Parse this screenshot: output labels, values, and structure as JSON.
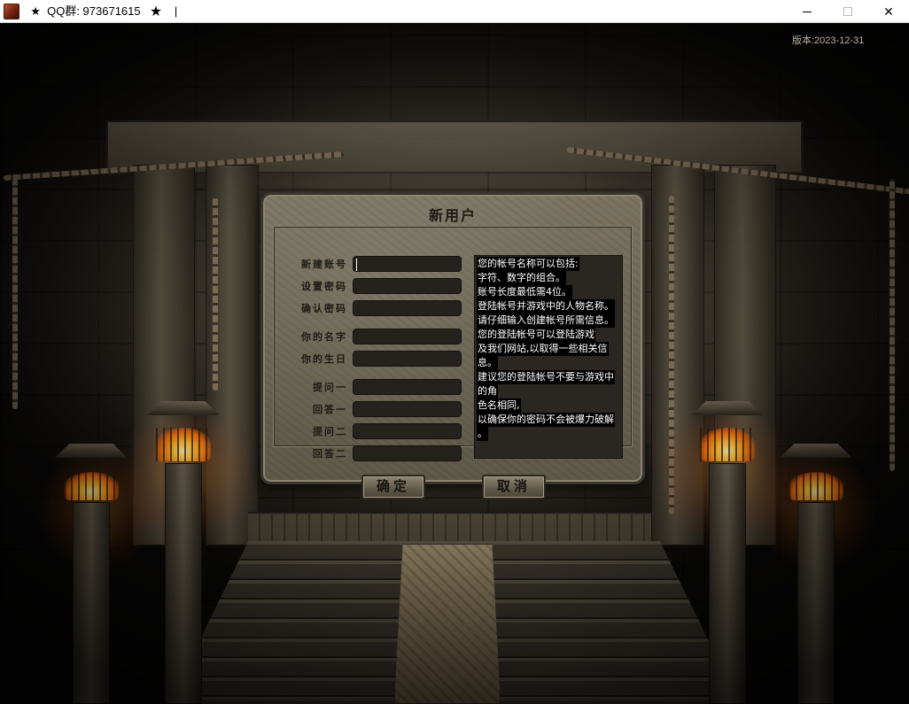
{
  "window": {
    "title": "  ★  QQ群: 973671615   ★    |",
    "minimize_glyph": "",
    "close_glyph": "✕"
  },
  "scene": {
    "version": "版本:2023-12-31"
  },
  "dialog": {
    "title": "新用户",
    "fields": [
      {
        "label": "新建账号",
        "value": ""
      },
      {
        "label": "设置密码",
        "value": ""
      },
      {
        "label": "确认密码",
        "value": ""
      },
      {
        "label": "你的名字",
        "value": ""
      },
      {
        "label": "你的生日",
        "value": ""
      },
      {
        "label": "提问一",
        "value": ""
      },
      {
        "label": "回答一",
        "value": ""
      },
      {
        "label": "提问二",
        "value": ""
      },
      {
        "label": "回答二",
        "value": ""
      }
    ],
    "info_lines": [
      "您的帐号名称可以包括:",
      "字符、数字的组合。",
      "账号长度最低需4位。",
      "登陆帐号并游戏中的人物名称。",
      "请仔细输入创建帐号所需信息。",
      "您的登陆帐号可以登陆游戏",
      "及我们网站,以取得一些相关信",
      "息。",
      "建议您的登陆帐号不要与游戏中",
      "的角",
      "色名相同,",
      "以确保你的密码不会被爆力破解",
      "。"
    ],
    "ok_label": "确定",
    "cancel_label": "取消"
  },
  "colors": {
    "dialog_stone": "#6b6553",
    "input_bg": "#25221d",
    "info_bg": "#2a2722",
    "fire": "#ffb52a"
  }
}
